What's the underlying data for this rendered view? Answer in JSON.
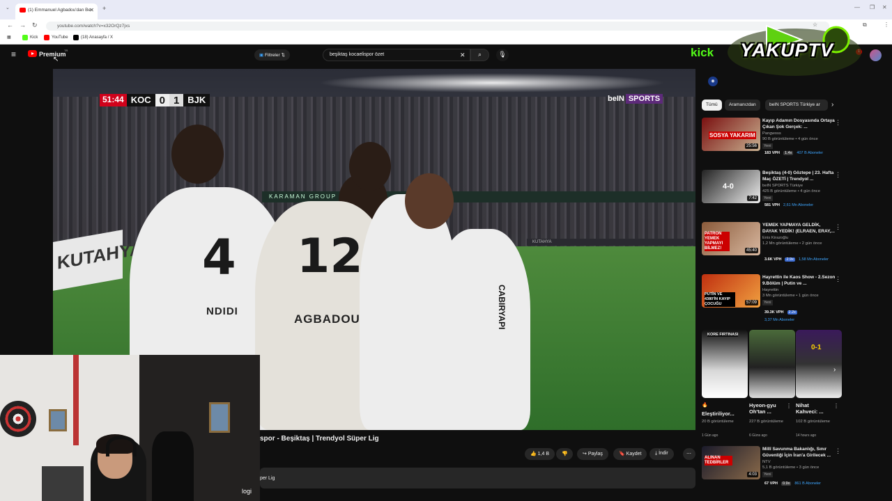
{
  "browser": {
    "tab_title": "(1) Emmanuel Agbadou'dan Be",
    "url": "youtube.com/watch?v=x32OrQz7jxs",
    "bookmarks": [
      "Kick",
      "YouTube",
      "(18) Anasayfa / X"
    ]
  },
  "youtube": {
    "logo_text": "Premium",
    "logo_sup": "TR",
    "filter_label": "Filtreler",
    "search_value": "beşiktaş kocaelispor özet",
    "notifications": "1"
  },
  "video": {
    "scoreboard": {
      "time": "51:44",
      "home": "KOC",
      "home_score": "0",
      "away_score": "1",
      "away": "BJK"
    },
    "broadcaster": "beIN",
    "broadcaster_suffix": "SPORTS",
    "jersey_numbers": [
      "4",
      "12"
    ],
    "jersey_names": [
      "NDIDI",
      "AGBADOU"
    ],
    "sponsor_text": "CABIRYAPI",
    "ad_text": "KUTAHYA",
    "board_text": "KARAMAN GROUP",
    "title": "spor - Beşiktaş | Trendyol Süper Lig",
    "description_snippet": "per Lig"
  },
  "actions": {
    "likes": "1,4 B",
    "share": "Paylaş",
    "save": "Kaydet",
    "download": "İndir"
  },
  "webcam": {
    "overlay_text": "logi"
  },
  "branding": {
    "kick": "kick",
    "yakup": "YAKUPTV"
  },
  "chips": [
    "Tümü",
    "Aramanızdan",
    "beIN SPORTS Türkiye ar"
  ],
  "recommendations": [
    {
      "thumb_text": "SOSYA YAKARIM",
      "duration": "25:56",
      "title": "Kayıp Adamın Dosyasında Ortaya Çıkan Şok Gerçek: ...",
      "channel": "Pangwoss",
      "views": "90 B görüntüleme • 4 gün önce",
      "badge": "Yeni",
      "vph": "183 VPH",
      "ratio": "1.4x",
      "subs": "407 B Aboneler"
    },
    {
      "thumb_text": "4-0",
      "duration": "7:42",
      "title": "Beşiktaş (4-0) Göztepe | 23. Hafta Maç ÖZETİ | Trendyol ...",
      "channel": "beIN SPORTS Türkiye",
      "views": "425 B görüntüleme • 4 gün önce",
      "badge": "Yeni",
      "vph": "581 VPH",
      "ratio": "",
      "subs": "2,61 Mn Aboneler"
    },
    {
      "thumb_text": "PATRON YEMEK YAPMAYI BİLMEZ!",
      "duration": "45:40",
      "title": "YEMEK YAPMAYA GELDİK, DAYAK YEDİK! (ELRAEN, ERAY,...",
      "channel": "Enis Kirazoğlu",
      "views": "1,2 Mn görüntüleme • 2 gün önce",
      "badge": "",
      "vph": "3.6K VPH",
      "ratio": "2.9x",
      "subs": "1,58 Mn Aboneler"
    },
    {
      "thumb_text": "PUTİN VE 4380'İN KAYIP ÇOCUĞU",
      "duration": "57:09",
      "title": "Hayrettin ile Kaos Show - 2.Sezon 9.Bölüm | Putin ve ...",
      "channel": "Hayrettin",
      "views": "3 Mn görüntüleme • 1 gün önce",
      "badge": "Yeni",
      "vph": "39.3K VPH",
      "ratio": "2.2x",
      "subs": "3,37 Mn Aboneler"
    }
  ],
  "shorts": [
    {
      "top_text": "KORE FIRTINASI",
      "title": "Eleştiriliyor...",
      "prefix": "🔥",
      "views": "20 B görüntüleme",
      "age": "1 Gün ago"
    },
    {
      "top_text": "",
      "title": "Hyeon-gyu Oh'tan ...",
      "prefix": "",
      "views": "227 B görüntüleme",
      "age": "6 Güns ago"
    },
    {
      "top_text": "0-1",
      "title": "Nihat Kahveci: ...",
      "prefix": "",
      "views": "102 B görüntüleme",
      "age": "14 hours ago"
    }
  ],
  "last_rec": {
    "thumb_text": "ALINAN TEDBİRLER",
    "duration": "4:03",
    "title": "Millî Savunma Bakanlığı, Sınır Güvenliği İçin İran'a Girilecek ...",
    "channel": "NTV",
    "views": "5,1 B görüntüleme • 3 gün önce",
    "badge": "Yeni",
    "vph": "67 VPH",
    "ratio": "0.9x",
    "subs": "861 B Aboneler"
  },
  "colors": {
    "yt_red": "#ff0000",
    "kick_green": "#53fc18",
    "link_blue": "#3ea6ff",
    "score_red": "#d0021b"
  }
}
